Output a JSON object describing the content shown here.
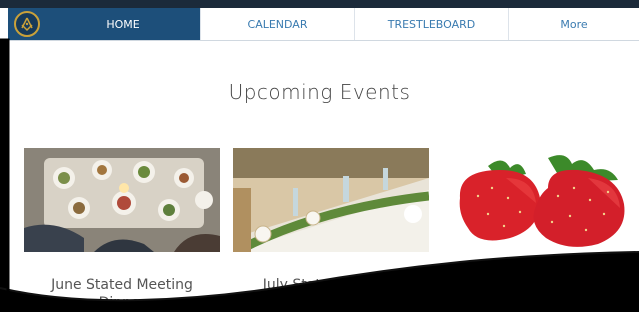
{
  "nav": {
    "items": [
      {
        "label": "HOME"
      },
      {
        "label": "CALENDAR"
      },
      {
        "label": "TRESTLEBOARD"
      },
      {
        "label": "More"
      }
    ]
  },
  "main": {
    "title": "Upcoming Events",
    "events": [
      {
        "name_line1": "June Stated Meeting",
        "name_line2": "Dinner"
      },
      {
        "name_line1": "July Stated Meeting",
        "name_line2": ""
      },
      {
        "name_line1": "",
        "name_line2": ""
      }
    ]
  },
  "colors": {
    "nav_active_bg": "#1d4f7a",
    "nav_text": "#3a7bb0",
    "logo_ring": "#c9a13a"
  },
  "icons": [
    "masonic-square-compass-logo"
  ]
}
